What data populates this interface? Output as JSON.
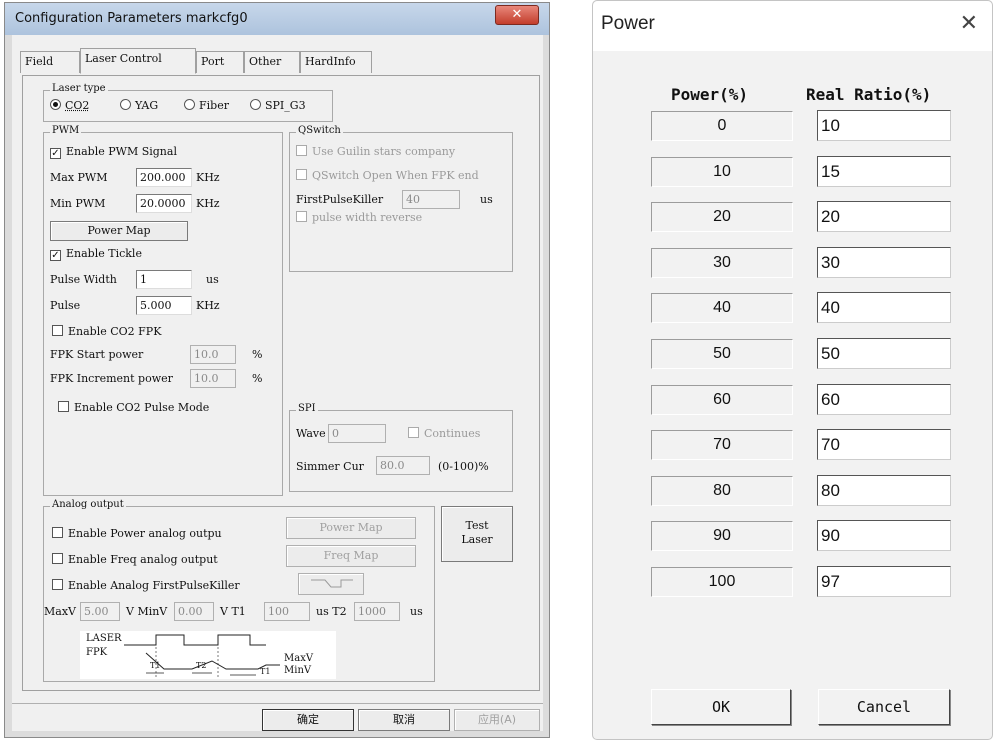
{
  "config_window": {
    "title": "Configuration Parameters markcfg0",
    "close_icon": "close-icon",
    "tabs": [
      "Field",
      "Laser Control",
      "Port",
      "Other",
      "HardInfo"
    ],
    "active_tab": "Laser Control",
    "laser_type": {
      "label": "Laser type",
      "options": [
        "CO2",
        "YAG",
        "Fiber",
        "SPI_G3"
      ],
      "selected": "CO2"
    },
    "pwm": {
      "label": "PWM",
      "enable_pwm_signal": "Enable PWM Signal",
      "max_pwm_label": "Max PWM",
      "max_pwm_value": "200.000",
      "min_pwm_label": "Min PWM",
      "min_pwm_value": "20.0000",
      "unit_khz": "KHz",
      "power_map_button": "Power Map",
      "enable_tickle": "Enable Tickle",
      "pulse_width_label": "Pulse Width",
      "pulse_width_value": "1",
      "pulse_width_unit": "us",
      "pulse_label": "Pulse",
      "pulse_value": "5.000",
      "enable_co2_fpk": "Enable CO2 FPK",
      "fpk_start_power_label": "FPK Start power",
      "fpk_start_power_value": "10.0",
      "fpk_increment_power_label": "FPK Increment power",
      "fpk_increment_power_value": "10.0",
      "percent": "%",
      "enable_co2_pulse_mode": "Enable CO2 Pulse Mode"
    },
    "qswitch": {
      "label": "QSwitch",
      "use_guilin": "Use Guilin stars company",
      "open_when_fpk_end": "QSwitch Open When FPK end",
      "first_pulse_killer_label": "FirstPulseKiller",
      "first_pulse_killer_value": "40",
      "unit": "us",
      "pulse_width_reverse": "pulse width reverse"
    },
    "spi": {
      "label": "SPI",
      "wave_label": "Wave",
      "wave_value": "0",
      "continues": "Continues",
      "simmer_cur_label": "Simmer Cur",
      "simmer_cur_value": "80.0",
      "range": "(0-100)%"
    },
    "analog_output": {
      "label": "Analog output",
      "enable_power_analog": "Enable Power analog outpu",
      "enable_freq_analog": "Enable Freq analog output",
      "enable_analog_fpk": "Enable Analog FirstPulseKiller",
      "power_map_button": "Power Map",
      "freq_map_button": "Freq Map",
      "maxv_label": "MaxV",
      "maxv_value": "5.00",
      "minv_label": "V MinV",
      "minv_value": "0.00",
      "t1_label": "V T1",
      "t1_value": "100",
      "t2_label": "us T2",
      "t2_value": "1000",
      "us": "us",
      "diagram": {
        "laser": "LASER",
        "fpk": "FPK",
        "t1": "T1",
        "t2": "T2",
        "maxv": "MaxV",
        "minv": "MinV"
      }
    },
    "test_laser_button": [
      "Test",
      "Laser"
    ],
    "ok_button": "确定",
    "cancel_button": "取消",
    "apply_button": "应用(A)"
  },
  "power_dialog": {
    "title": "Power",
    "close_icon": "close-icon",
    "col_power": "Power(%)",
    "col_ratio": "Real Ratio(%)",
    "rows": [
      {
        "power": "0",
        "ratio": "10"
      },
      {
        "power": "10",
        "ratio": "15"
      },
      {
        "power": "20",
        "ratio": "20"
      },
      {
        "power": "30",
        "ratio": "30"
      },
      {
        "power": "40",
        "ratio": "40"
      },
      {
        "power": "50",
        "ratio": "50"
      },
      {
        "power": "60",
        "ratio": "60"
      },
      {
        "power": "70",
        "ratio": "70"
      },
      {
        "power": "80",
        "ratio": "80"
      },
      {
        "power": "90",
        "ratio": "90"
      },
      {
        "power": "100",
        "ratio": "97"
      }
    ],
    "ok_button": "OK",
    "cancel_button": "Cancel"
  }
}
